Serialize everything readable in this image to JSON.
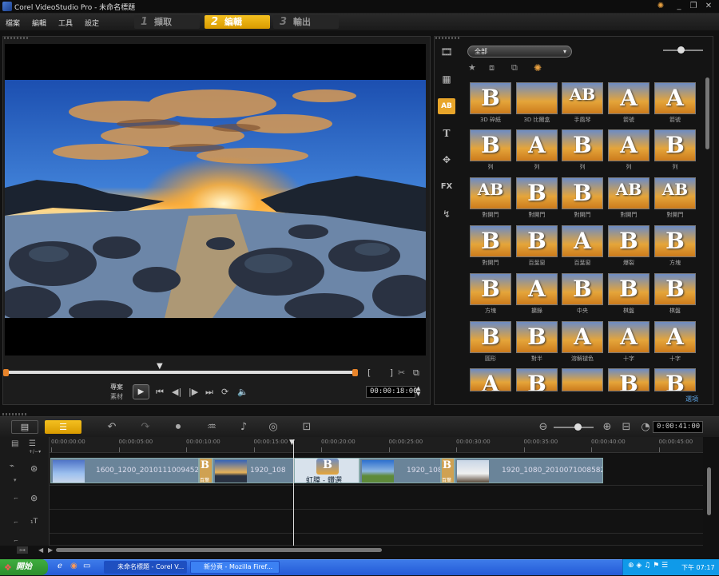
{
  "window": {
    "title": "Corel VideoStudio Pro - 未命名標題"
  },
  "menu": [
    "檔案",
    "編輯",
    "工具",
    "設定"
  ],
  "steps": [
    {
      "num": "1",
      "label": "擷取"
    },
    {
      "num": "2",
      "label": "編輯"
    },
    {
      "num": "3",
      "label": "輸出"
    }
  ],
  "player": {
    "mode_project": "專案",
    "mode_clip": "素材",
    "timecode": "00:00:18:00",
    "trim_brackets": "[ ]"
  },
  "library": {
    "category": "全部",
    "more_label": "選項",
    "side_icons": [
      "media-icon",
      "instant-project-icon",
      "transition-icon",
      "title-icon",
      "graphic-icon",
      "fx-icon",
      "path-icon"
    ],
    "items": [
      {
        "letter": "B",
        "label": "3D 碎紙"
      },
      {
        "letter": "",
        "label": "3D 比爾盒"
      },
      {
        "letter": "AB",
        "label": "手風琴"
      },
      {
        "letter": "A",
        "label": "箭號"
      },
      {
        "letter": "A",
        "label": "箭號"
      },
      {
        "letter": "B",
        "label": "列"
      },
      {
        "letter": "A",
        "label": "列"
      },
      {
        "letter": "B",
        "label": "列"
      },
      {
        "letter": "A",
        "label": "列"
      },
      {
        "letter": "B",
        "label": "列"
      },
      {
        "letter": "AB",
        "label": "對開門"
      },
      {
        "letter": "B",
        "label": "對開門"
      },
      {
        "letter": "B",
        "label": "對開門"
      },
      {
        "letter": "AB",
        "label": "對開門"
      },
      {
        "letter": "AB",
        "label": "對開門"
      },
      {
        "letter": "B",
        "label": "對開門"
      },
      {
        "letter": "B",
        "label": "百葉窗"
      },
      {
        "letter": "A",
        "label": "百葉窗"
      },
      {
        "letter": "B",
        "label": "爆裂"
      },
      {
        "letter": "B",
        "label": "方塊"
      },
      {
        "letter": "B",
        "label": "方塊"
      },
      {
        "letter": "A",
        "label": "擴錄"
      },
      {
        "letter": "B",
        "label": "中央"
      },
      {
        "letter": "B",
        "label": "棋盤"
      },
      {
        "letter": "B",
        "label": "棋盤"
      },
      {
        "letter": "B",
        "label": "圓形"
      },
      {
        "letter": "B",
        "label": "對半"
      },
      {
        "letter": "A",
        "label": "溶解褪色"
      },
      {
        "letter": "A",
        "label": "十字"
      },
      {
        "letter": "A",
        "label": "十字"
      },
      {
        "letter": "A",
        "label": ""
      },
      {
        "letter": "B",
        "label": ""
      },
      {
        "letter": "",
        "label": ""
      },
      {
        "letter": "B",
        "label": ""
      },
      {
        "letter": "B",
        "label": ""
      }
    ]
  },
  "timeline": {
    "timecode": "0:00:41:00",
    "ruler": [
      "00:00:00:00",
      "00:00:05:00",
      "00:00:10:00",
      "00:00:15:00",
      "00:00:20:00",
      "00:00:25:00",
      "00:00:30:00",
      "00:00:35:00",
      "00:00:40:00",
      "00:00:45:00"
    ],
    "clips": [
      {
        "label": "1600_1200_20101110094522"
      },
      {
        "label": "1920_108"
      },
      {
        "label": "虹膜 - 鑽選"
      },
      {
        "label": "1920_108"
      },
      {
        "label": "1920_1080_20100710085820"
      }
    ],
    "transitions": [
      "百葉",
      "百葉"
    ]
  },
  "taskbar": {
    "start": "開始",
    "tasks": [
      "未命名標題 - Corel V...",
      "新分頁 - Mozilla Firef..."
    ],
    "clock": "下午 07:17"
  },
  "colors": {
    "accent": "#f0b81c",
    "clip": "#6a8499",
    "taskbar": "#245ad6"
  }
}
